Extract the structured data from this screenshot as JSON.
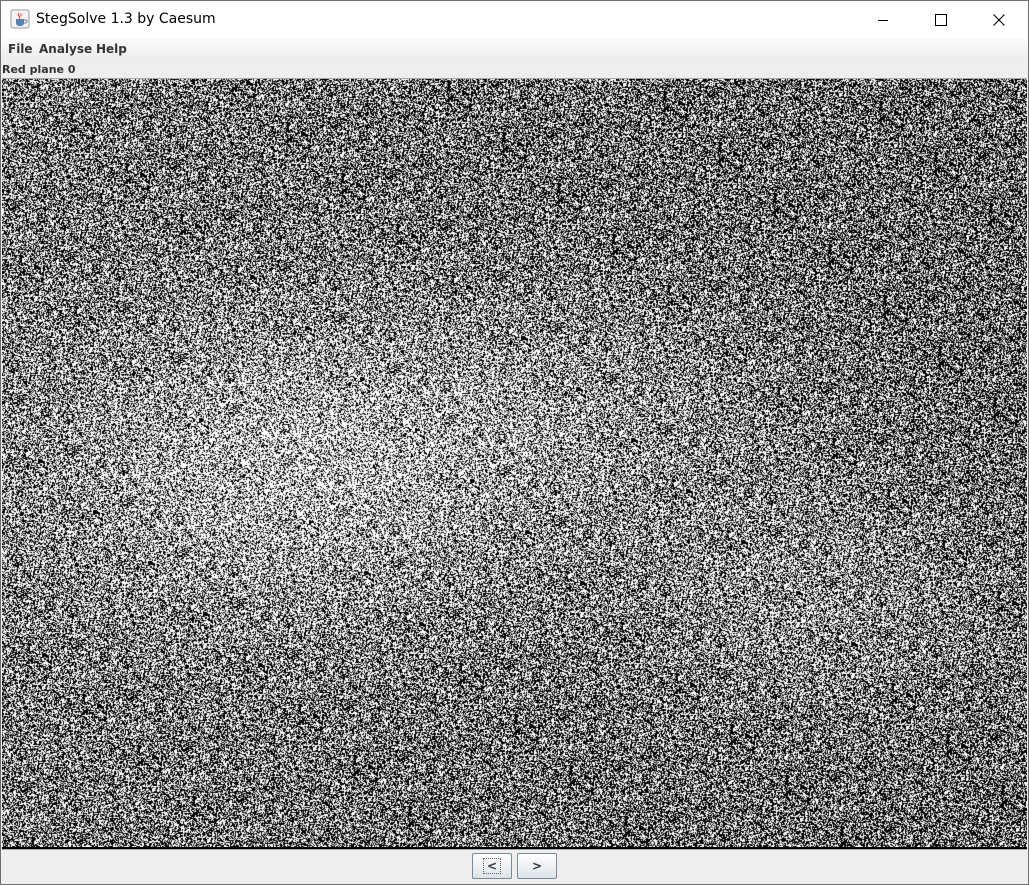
{
  "window": {
    "title": "StegSolve 1.3 by Caesum",
    "app_icon": "java-coffee-cup-icon",
    "controls": {
      "minimize": "minimize-icon",
      "maximize": "maximize-icon",
      "close": "close-icon"
    }
  },
  "menu": {
    "items": [
      {
        "label": "File"
      },
      {
        "label": "Analyse"
      },
      {
        "label": "Help"
      }
    ]
  },
  "view": {
    "plane_label": "Red plane 0"
  },
  "navigation": {
    "prev_label": "<",
    "next_label": ">"
  },
  "colors": {
    "titlebar_bg": "#ffffff",
    "window_bg": "#eeeeee",
    "bit_set": "#ffffff",
    "bit_clear": "#000000"
  }
}
